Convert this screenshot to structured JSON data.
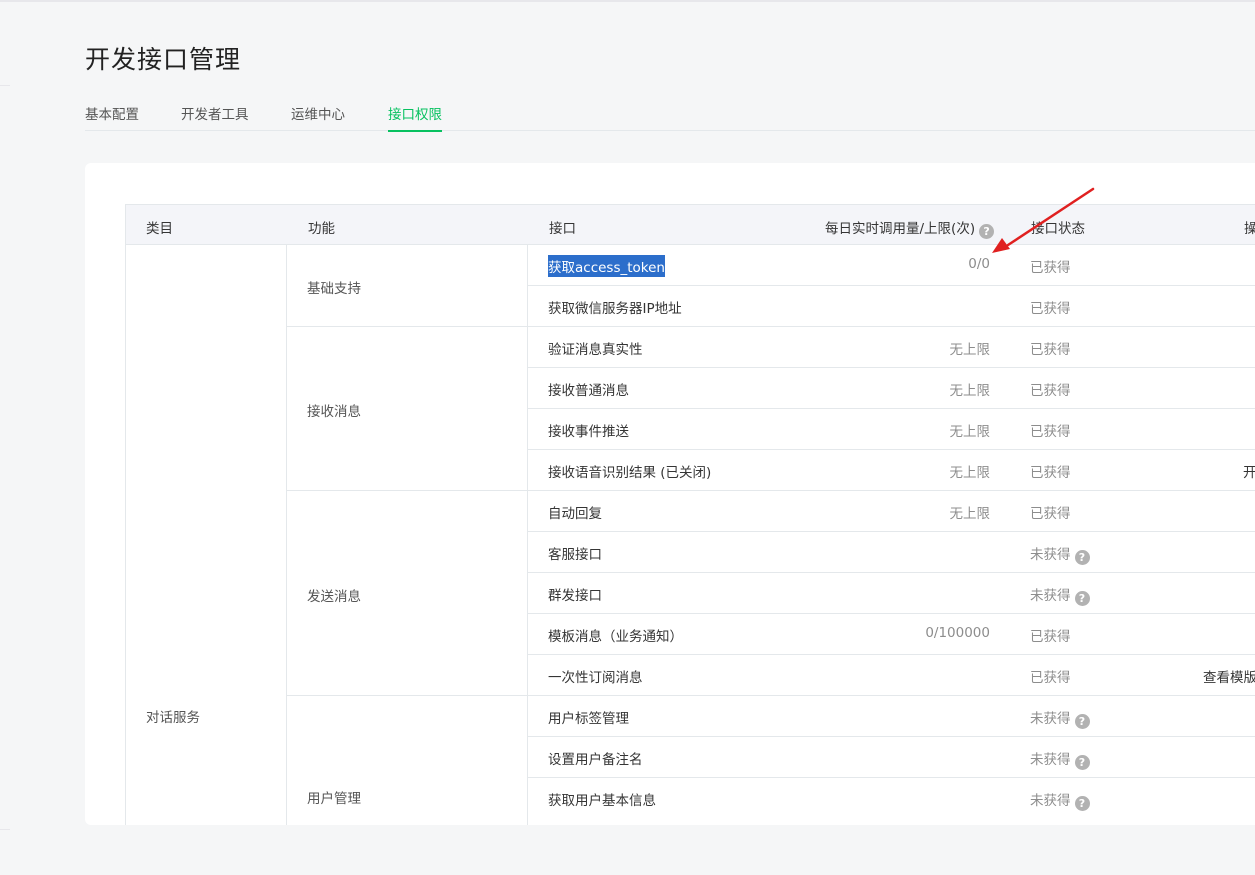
{
  "page": {
    "title": "开发接口管理"
  },
  "tabs": [
    {
      "label": "基本配置"
    },
    {
      "label": "开发者工具"
    },
    {
      "label": "运维中心"
    },
    {
      "label": "接口权限",
      "active": true
    }
  ],
  "table": {
    "headers": {
      "category": "类目",
      "function": "功能",
      "interface": "接口",
      "quota": "每日实时调用量/上限(次)",
      "status": "接口状态",
      "operation": "操"
    },
    "category": "对话服务",
    "groups": [
      {
        "name": "基础支持",
        "rows": [
          {
            "api": "获取access_token",
            "quota": "0/0",
            "status": "已获得",
            "selected": true
          },
          {
            "api": "获取微信服务器IP地址",
            "quota": "",
            "status": "已获得"
          }
        ]
      },
      {
        "name": "接收消息",
        "rows": [
          {
            "api": "验证消息真实性",
            "quota": "无上限",
            "status": "已获得"
          },
          {
            "api": "接收普通消息",
            "quota": "无上限",
            "status": "已获得"
          },
          {
            "api": "接收事件推送",
            "quota": "无上限",
            "status": "已获得"
          },
          {
            "api": "接收语音识别结果 (已关闭)",
            "quota": "无上限",
            "status": "已获得",
            "action": "开"
          }
        ]
      },
      {
        "name": "发送消息",
        "rows": [
          {
            "api": "自动回复",
            "quota": "无上限",
            "status": "已获得"
          },
          {
            "api": "客服接口",
            "quota": "",
            "status": "未获得",
            "help": true
          },
          {
            "api": "群发接口",
            "quota": "",
            "status": "未获得",
            "help": true
          },
          {
            "api": "模板消息（业务通知）",
            "quota": "0/100000",
            "status": "已获得"
          },
          {
            "api": "一次性订阅消息",
            "quota": "",
            "status": "已获得",
            "action": "查看模版"
          }
        ]
      },
      {
        "name": "用户管理",
        "rows": [
          {
            "api": "用户标签管理",
            "quota": "",
            "status": "未获得",
            "help": true
          },
          {
            "api": "设置用户备注名",
            "quota": "",
            "status": "未获得",
            "help": true
          },
          {
            "api": "获取用户基本信息",
            "quota": "",
            "status": "未获得",
            "help": true
          }
        ]
      }
    ]
  },
  "icons": {
    "help": "question-circle-icon",
    "annotation": "red-arrow-annotation"
  },
  "colors": {
    "accent": "#07c160",
    "selection": "#2c6ecb",
    "arrow": "#e02020",
    "header_bg": "#f4f5f9",
    "muted_text": "#8d8d8d"
  }
}
